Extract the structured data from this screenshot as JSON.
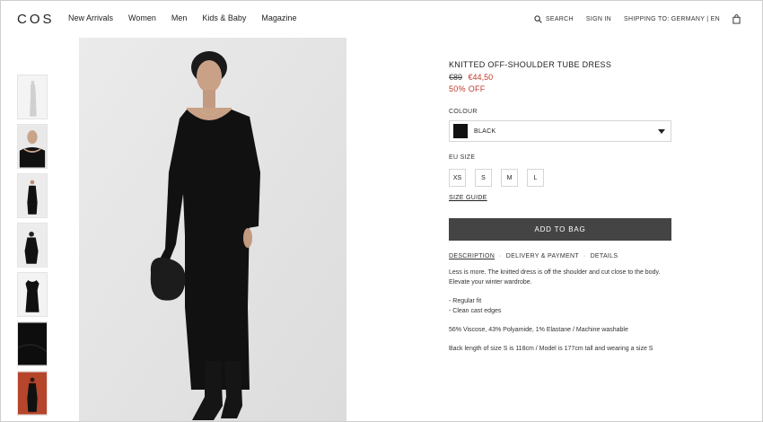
{
  "header": {
    "logo": "COS",
    "nav": [
      "New Arrivals",
      "Women",
      "Men",
      "Kids & Baby",
      "Magazine"
    ],
    "search_label": "SEARCH",
    "signin_label": "SIGN IN",
    "shipping_label": "SHIPPING TO: GERMANY | EN"
  },
  "product": {
    "title": "KNITTED OFF-SHOULDER TUBE DRESS",
    "old_price": "€89",
    "new_price": "€44,50",
    "discount": "50% OFF",
    "colour_label": "COLOUR",
    "colour_value": "BLACK",
    "size_label": "EU SIZE",
    "sizes": [
      "XS",
      "S",
      "M",
      "L"
    ],
    "size_guide": "SIZE GUIDE",
    "add_to_bag": "ADD TO BAG",
    "tabs": [
      "DESCRIPTION",
      "DELIVERY & PAYMENT",
      "DETAILS"
    ],
    "description": [
      "Less is more. The knitted dress is off the shoulder and cut close to the body. Elevate your winter wardrobe.",
      "- Regular fit",
      "- Clean cast edges",
      "56% Viscose, 43% Polyamide, 1% Elastane / Machine washable",
      "Back length of size S is 118cm / Model is 177cm tall and wearing a size S"
    ]
  },
  "colors": {
    "sale": "#c0392b",
    "button": "#444444",
    "dress": "#111111"
  }
}
